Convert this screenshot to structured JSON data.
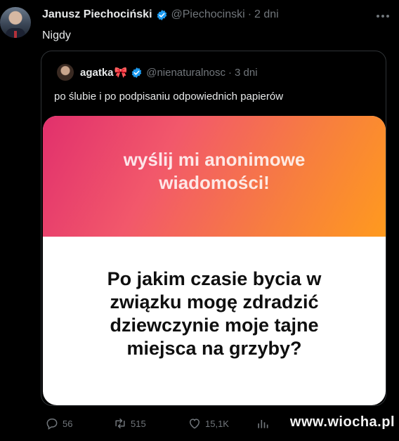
{
  "tweet": {
    "author_name": "Janusz Piechociński",
    "author_handle": "@Piechocinski",
    "time": "2 dni",
    "text": "Nigdy"
  },
  "quoted": {
    "author_name": "agatka",
    "author_handle": "@nienaturalnosc",
    "time": "3 dni",
    "text": "po ślubie i po podpisaniu odpowiednich papierów"
  },
  "card": {
    "title_line1": "wyślij mi anonimowe",
    "title_line2": "wiadomości!",
    "question_line1": "Po jakim czasie bycia w",
    "question_line2": "związku mogę zdradzić",
    "question_line3": "dziewczynie moje tajne",
    "question_line4": "miejsca na grzyby?"
  },
  "actions": {
    "replies": "56",
    "reposts": "515",
    "likes": "15,1K"
  },
  "separator": "·",
  "watermark": "www.wiocha.pl",
  "colors": {
    "background": "#000000",
    "text_primary": "#e7e9ea",
    "text_secondary": "#71767b",
    "verified": "#1d9bf0",
    "gradient_start": "#e1306c",
    "gradient_end": "#ff9a1e"
  }
}
